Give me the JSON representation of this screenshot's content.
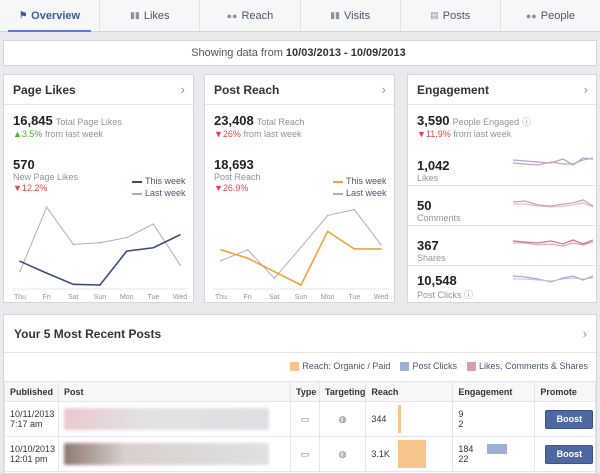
{
  "tabs": [
    {
      "label": "Overview",
      "icon": "flag-icon",
      "active": true
    },
    {
      "label": "Likes",
      "icon": "bar-chart-icon"
    },
    {
      "label": "Reach",
      "icon": "people-icon"
    },
    {
      "label": "Visits",
      "icon": "bar-chart-icon"
    },
    {
      "label": "Posts",
      "icon": "document-icon"
    },
    {
      "label": "People",
      "icon": "people-icon"
    }
  ],
  "date_range": {
    "prefix": "Showing data from",
    "range": "10/03/2013 - 10/09/2013"
  },
  "page_likes": {
    "title": "Page Likes",
    "total": "16,845",
    "total_label": "Total Page Likes",
    "total_change": "▲3.5%",
    "total_change_label": "from last week",
    "new": "570",
    "new_label": "New Page Likes",
    "new_change": "▼12.2%",
    "legend_this": "This week",
    "legend_last": "Last week"
  },
  "post_reach": {
    "title": "Post Reach",
    "total": "23,408",
    "total_label": "Total Reach",
    "total_change": "▼26%",
    "total_change_label": "from last week",
    "post": "18,693",
    "post_label": "Post Reach",
    "post_change": "▼26.9%",
    "legend_this": "This week",
    "legend_last": "Last week"
  },
  "engagement": {
    "title": "Engagement",
    "total": "3,590",
    "total_label": "People Engaged",
    "total_change": "▼11.9%",
    "total_change_label": "from last week",
    "items": [
      {
        "value": "1,042",
        "label": "Likes"
      },
      {
        "value": "50",
        "label": "Comments"
      },
      {
        "value": "367",
        "label": "Shares"
      },
      {
        "value": "10,548",
        "label": "Post Clicks"
      }
    ]
  },
  "chart_data": [
    {
      "type": "line",
      "title": "",
      "categories": [
        "Thu",
        "Fri",
        "Sat",
        "Sun",
        "Mon",
        "Tue",
        "Wed"
      ],
      "series": [
        {
          "name": "This week",
          "values": [
            70,
            35,
            2,
            0,
            100,
            110,
            148
          ],
          "color": "#3b4d7a"
        },
        {
          "name": "Last week",
          "values": [
            40,
            230,
            120,
            125,
            140,
            180,
            60
          ],
          "color": "#b0b0b0"
        }
      ],
      "ylim": [
        0,
        260
      ]
    },
    {
      "type": "line",
      "title": "",
      "categories": [
        "Thu",
        "Fri",
        "Sat",
        "Sun",
        "Mon",
        "Tue",
        "Wed"
      ],
      "series": [
        {
          "name": "This week",
          "values": [
            4200,
            3200,
            1600,
            0,
            6400,
            4300,
            4300
          ],
          "color": "#f0a33a"
        },
        {
          "name": "Last week",
          "values": [
            2900,
            4200,
            800,
            4500,
            8300,
            9000,
            4800
          ],
          "color": "#b0b0b0"
        }
      ],
      "ylim": [
        0,
        10500
      ]
    }
  ],
  "colors": {
    "this_week": "#3b4d7a",
    "this_week_reach": "#f0a33a",
    "last_week": "#b0b0b0",
    "accent": "#3b5998",
    "up": "#42b72a",
    "down": "#e0444a"
  },
  "posts": {
    "title": "Your 5 Most Recent Posts",
    "legend": [
      "Reach: Organic / Paid",
      "Post Clicks",
      "Likes, Comments & Shares"
    ],
    "legend_colors": [
      "#f7c58c",
      "#9eafd8",
      "#d7a0ac"
    ],
    "columns": [
      "Published",
      "Post",
      "Type",
      "Targeting",
      "Reach",
      "Engagement",
      "Promote"
    ],
    "rows": [
      {
        "date": "10/11/2013",
        "time": "7:17 am",
        "reach": "344",
        "eng1": "9",
        "eng2": "2",
        "promote": "Boost",
        "reach_frac": 0.1,
        "clicks_frac": 0.0
      },
      {
        "date": "10/10/2013",
        "time": "12:01 pm",
        "reach": "3.1K",
        "eng1": "184",
        "eng2": "22",
        "promote": "Boost",
        "reach_frac": 1.0,
        "clicks_frac": 1.0
      }
    ]
  }
}
